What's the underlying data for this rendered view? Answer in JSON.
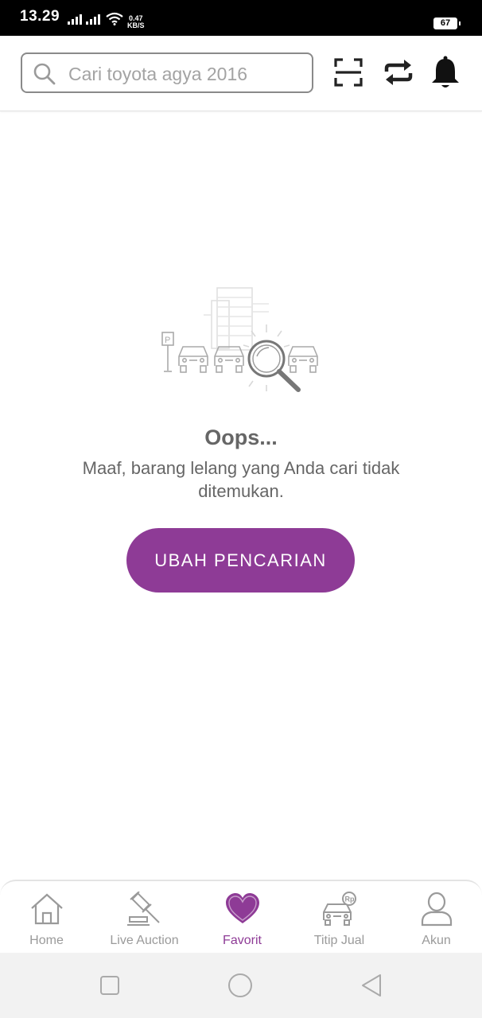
{
  "status_bar": {
    "time": "13.29",
    "speed_value": "0.47",
    "speed_unit": "KB/S",
    "battery": "67"
  },
  "header": {
    "search_placeholder": "Cari toyota agya 2016",
    "icons": [
      "search-icon",
      "scan-icon",
      "swap-icon",
      "bell-icon"
    ]
  },
  "empty_state": {
    "title": "Oops...",
    "message": "Maaf, barang lelang yang Anda cari tidak ditemukan.",
    "button_label": "UBAH PENCARIAN"
  },
  "bottom_nav": {
    "items": [
      {
        "label": "Home",
        "icon": "home-icon",
        "active": false
      },
      {
        "label": "Live Auction",
        "icon": "gavel-icon",
        "active": false
      },
      {
        "label": "Favorit",
        "icon": "heart-icon",
        "active": true
      },
      {
        "label": "Titip Jual",
        "icon": "car-sell-icon",
        "active": false
      },
      {
        "label": "Akun",
        "icon": "user-icon",
        "active": false
      }
    ]
  },
  "colors": {
    "accent": "#8e3b96",
    "inactive": "#9a9a9a",
    "text_muted": "#666666"
  }
}
